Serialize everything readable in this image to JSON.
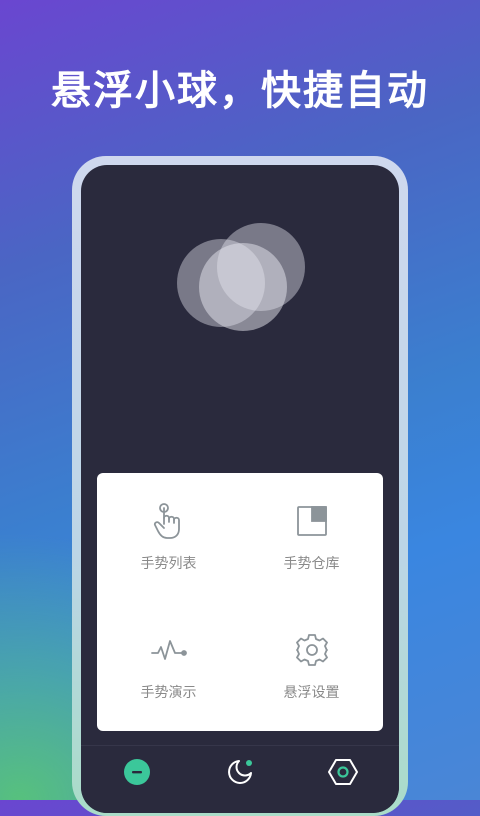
{
  "headline": "悬浮小球，快捷自动",
  "menu": {
    "items": [
      {
        "label": "手势列表",
        "icon": "tap-hand-icon"
      },
      {
        "label": "手势仓库",
        "icon": "warehouse-icon"
      },
      {
        "label": "手势演示",
        "icon": "wave-icon"
      },
      {
        "label": "悬浮设置",
        "icon": "gear-icon"
      }
    ]
  },
  "bottom_nav": {
    "items": [
      {
        "icon": "ball-minus-icon"
      },
      {
        "icon": "moon-icon"
      },
      {
        "icon": "hexagon-icon"
      }
    ]
  },
  "colors": {
    "accent": "#3bc79a",
    "screen_bg": "#2a2a3d",
    "icon_gray": "#8c9499"
  }
}
